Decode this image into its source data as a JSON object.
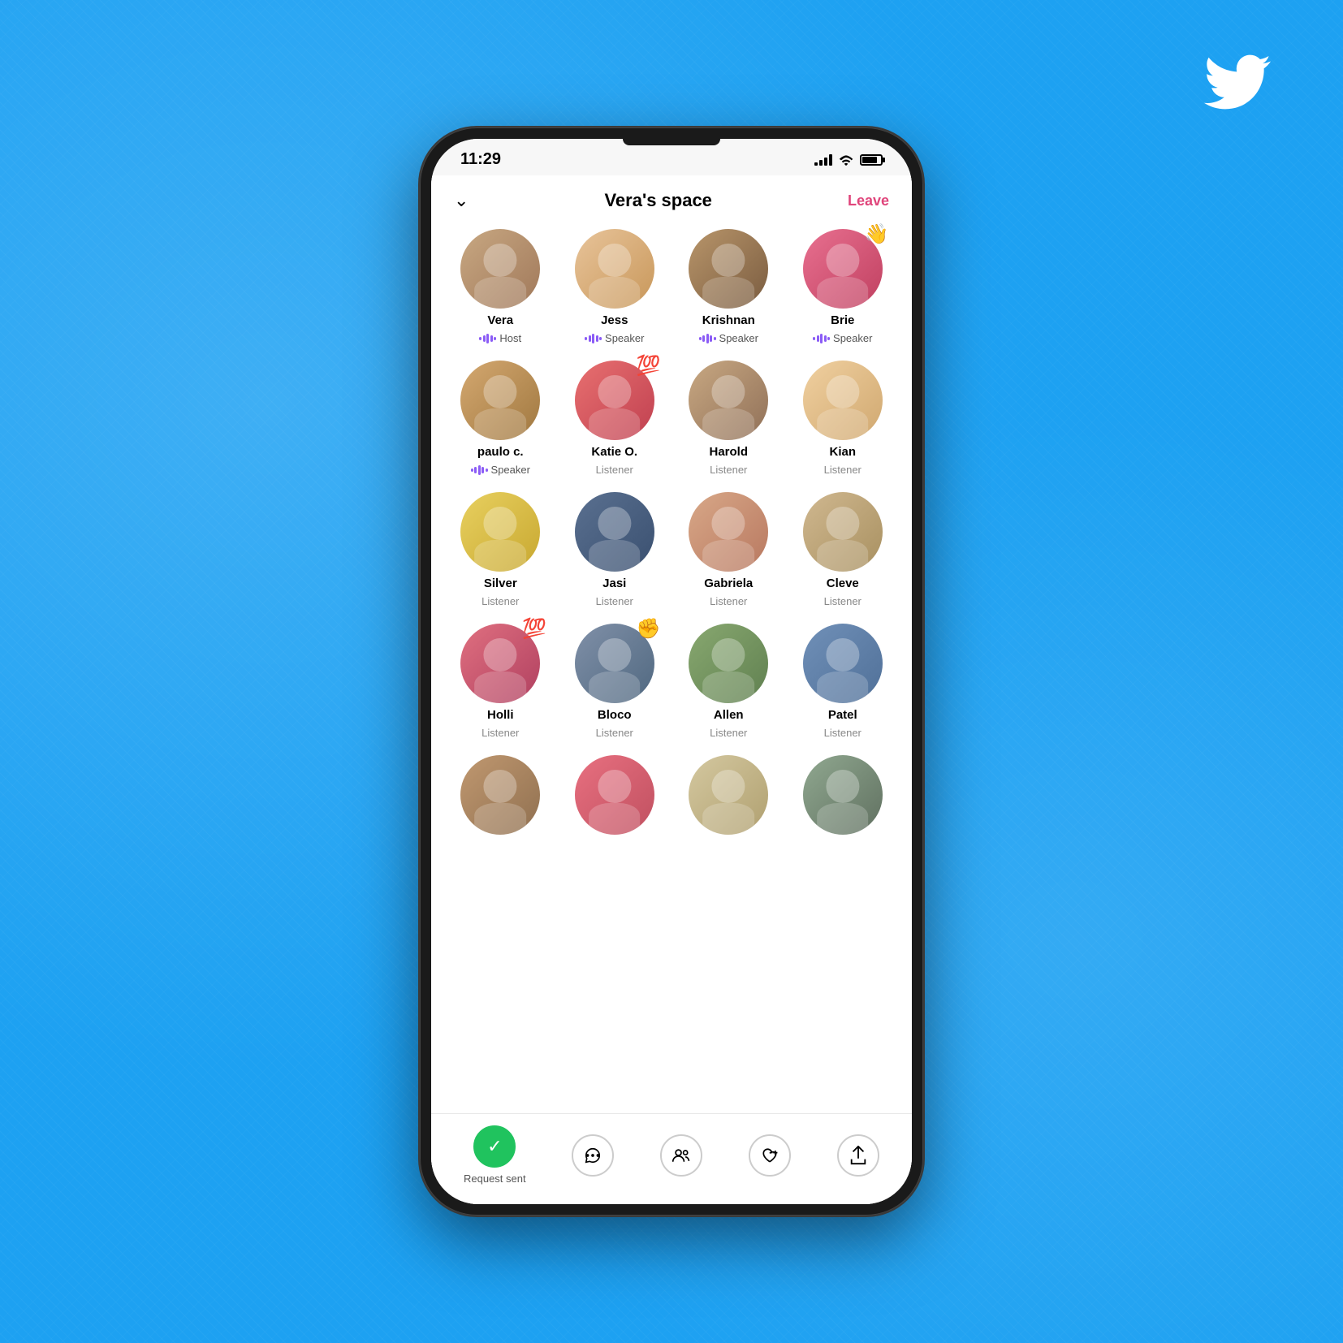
{
  "background": "#1da1f2",
  "statusBar": {
    "time": "11:29",
    "batteryLevel": 80
  },
  "header": {
    "title": "Vera's space",
    "leaveLabel": "Leave",
    "chevronLabel": "chevron down"
  },
  "participants": [
    {
      "id": "vera",
      "name": "Vera",
      "role": "Host",
      "isSpeaker": true,
      "emoji": null,
      "avatarClass": "av-vera"
    },
    {
      "id": "jess",
      "name": "Jess",
      "role": "Speaker",
      "isSpeaker": true,
      "emoji": null,
      "avatarClass": "av-jess"
    },
    {
      "id": "krishnan",
      "name": "Krishnan",
      "role": "Speaker",
      "isSpeaker": true,
      "emoji": null,
      "avatarClass": "av-krishnan"
    },
    {
      "id": "brie",
      "name": "Brie",
      "role": "Speaker",
      "isSpeaker": true,
      "emoji": "👋",
      "avatarClass": "av-brie"
    },
    {
      "id": "paulo",
      "name": "paulo c.",
      "role": "Speaker",
      "isSpeaker": true,
      "emoji": null,
      "avatarClass": "av-paulo"
    },
    {
      "id": "katie",
      "name": "Katie O.",
      "role": "Listener",
      "isSpeaker": false,
      "emoji": "💯",
      "avatarClass": "av-katie"
    },
    {
      "id": "harold",
      "name": "Harold",
      "role": "Listener",
      "isSpeaker": false,
      "emoji": null,
      "avatarClass": "av-harold"
    },
    {
      "id": "kian",
      "name": "Kian",
      "role": "Listener",
      "isSpeaker": false,
      "emoji": null,
      "avatarClass": "av-kian"
    },
    {
      "id": "silver",
      "name": "Silver",
      "role": "Listener",
      "isSpeaker": false,
      "emoji": null,
      "avatarClass": "av-silver"
    },
    {
      "id": "jasi",
      "name": "Jasi",
      "role": "Listener",
      "isSpeaker": false,
      "emoji": null,
      "avatarClass": "av-jasi"
    },
    {
      "id": "gabriela",
      "name": "Gabriela",
      "role": "Listener",
      "isSpeaker": false,
      "emoji": null,
      "avatarClass": "av-gabriela"
    },
    {
      "id": "cleve",
      "name": "Cleve",
      "role": "Listener",
      "isSpeaker": false,
      "emoji": null,
      "avatarClass": "av-cleve"
    },
    {
      "id": "holli",
      "name": "Holli",
      "role": "Listener",
      "isSpeaker": false,
      "emoji": "💯",
      "avatarClass": "av-holli"
    },
    {
      "id": "bloco",
      "name": "Bloco",
      "role": "Listener",
      "isSpeaker": false,
      "emoji": "✊",
      "avatarClass": "av-bloco"
    },
    {
      "id": "allen",
      "name": "Allen",
      "role": "Listener",
      "isSpeaker": false,
      "emoji": null,
      "avatarClass": "av-allen"
    },
    {
      "id": "patel",
      "name": "Patel",
      "role": "Listener",
      "isSpeaker": false,
      "emoji": null,
      "avatarClass": "av-patel"
    },
    {
      "id": "p17",
      "name": "",
      "role": "",
      "isSpeaker": false,
      "emoji": null,
      "avatarClass": "av-p17"
    },
    {
      "id": "p18",
      "name": "",
      "role": "",
      "isSpeaker": false,
      "emoji": null,
      "avatarClass": "av-p18"
    },
    {
      "id": "p19",
      "name": "",
      "role": "",
      "isSpeaker": false,
      "emoji": null,
      "avatarClass": "av-p19"
    },
    {
      "id": "p20",
      "name": "",
      "role": "",
      "isSpeaker": false,
      "emoji": null,
      "avatarClass": "av-p20"
    }
  ],
  "bottomBar": {
    "requestLabel": "Request sent",
    "requestIcon": "✓",
    "chatIcon": "⋯",
    "peopleIcon": "👥",
    "heartIcon": "♡+",
    "shareIcon": "↑"
  },
  "twitterBird": "🐦"
}
